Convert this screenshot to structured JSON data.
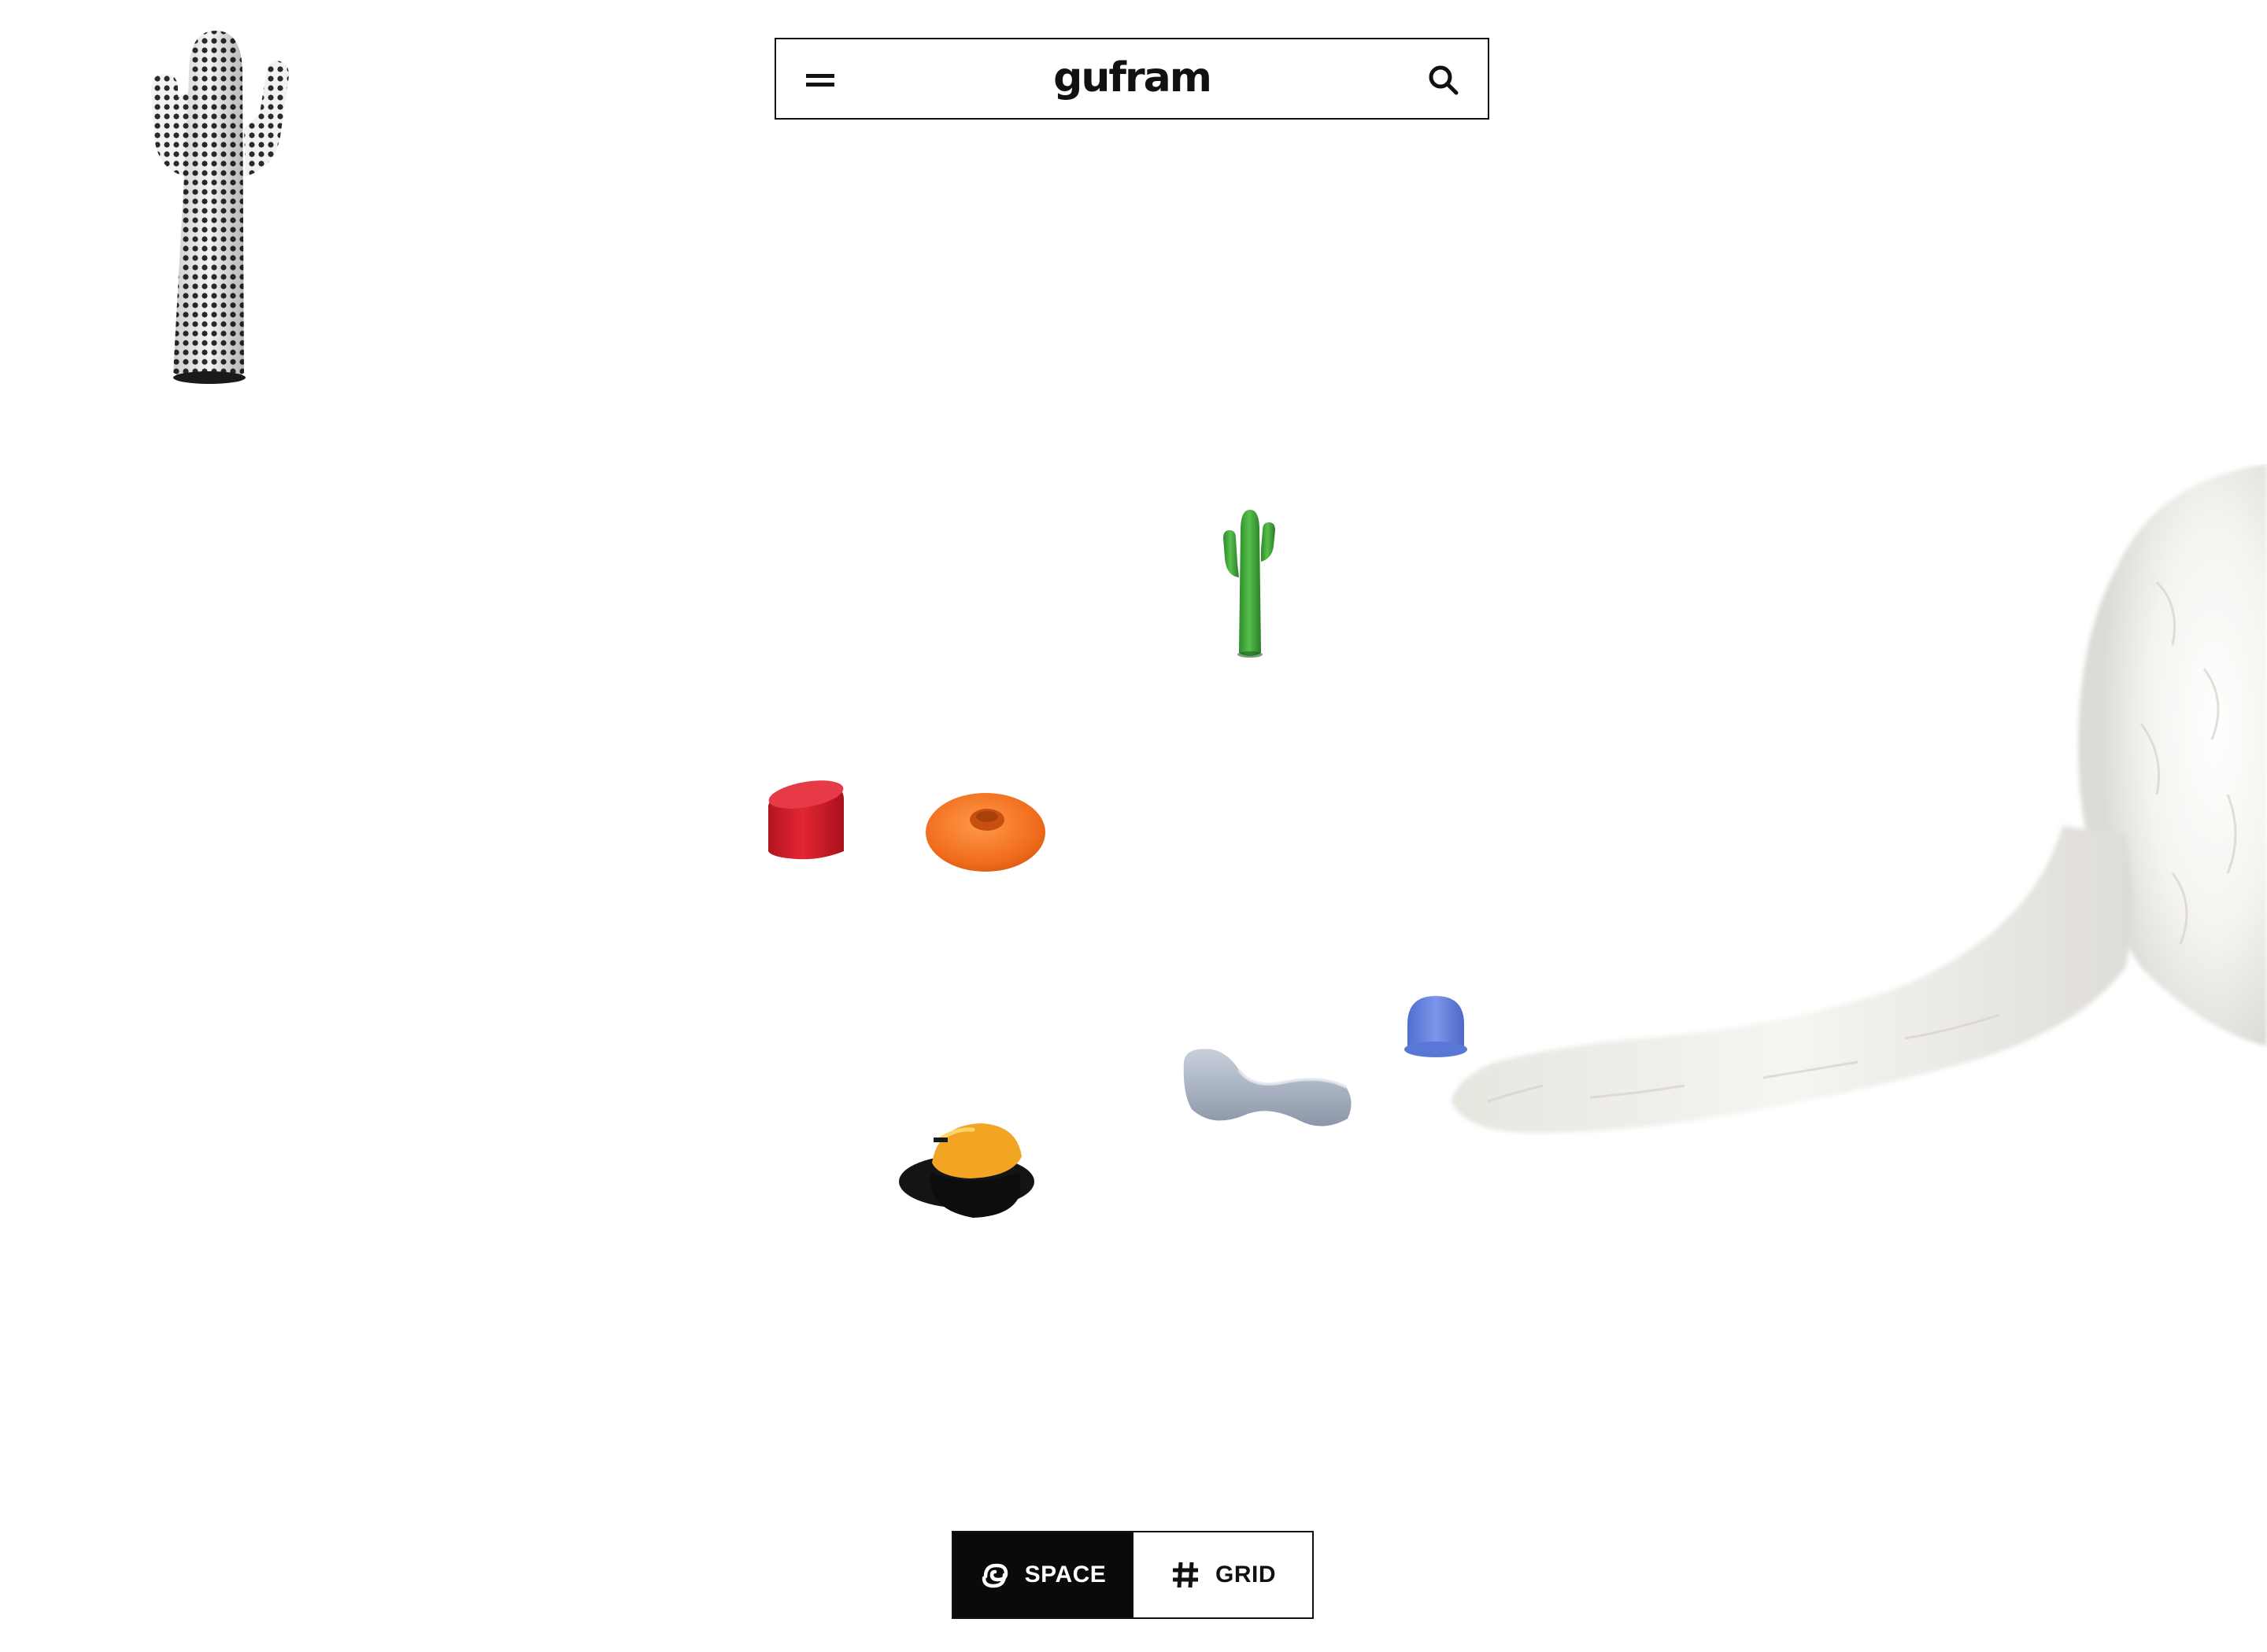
{
  "header": {
    "brand": "gufram",
    "menu_icon": "menu-icon",
    "search_icon": "search-icon"
  },
  "products": [
    {
      "id": "cactus-pop-art",
      "icon": "polka-dot-cactus"
    },
    {
      "id": "cactus-green",
      "icon": "green-cactus"
    },
    {
      "id": "red-stool",
      "icon": "red-cylinder-stool"
    },
    {
      "id": "orange-donut",
      "icon": "orange-donut-pouf"
    },
    {
      "id": "blue-dome",
      "icon": "blue-dome-object"
    },
    {
      "id": "grey-chaise",
      "icon": "grey-wave-chaise"
    },
    {
      "id": "yellow-black-hat",
      "icon": "hat-shaped-pouf"
    },
    {
      "id": "white-fur-animal",
      "icon": "white-fur-bear"
    }
  ],
  "view_toggle": {
    "space_label": "SPACE",
    "grid_label": "GRID",
    "active": "space"
  },
  "colors": {
    "ink": "#111111",
    "background": "#ffffff",
    "cactus_green": "#3aa83a",
    "stool_red": "#d81e2c",
    "donut_orange": "#f07a2a",
    "dome_blue": "#6a86e0",
    "chaise_grey": "#aab4c4",
    "hat_yellow": "#f2a523"
  }
}
